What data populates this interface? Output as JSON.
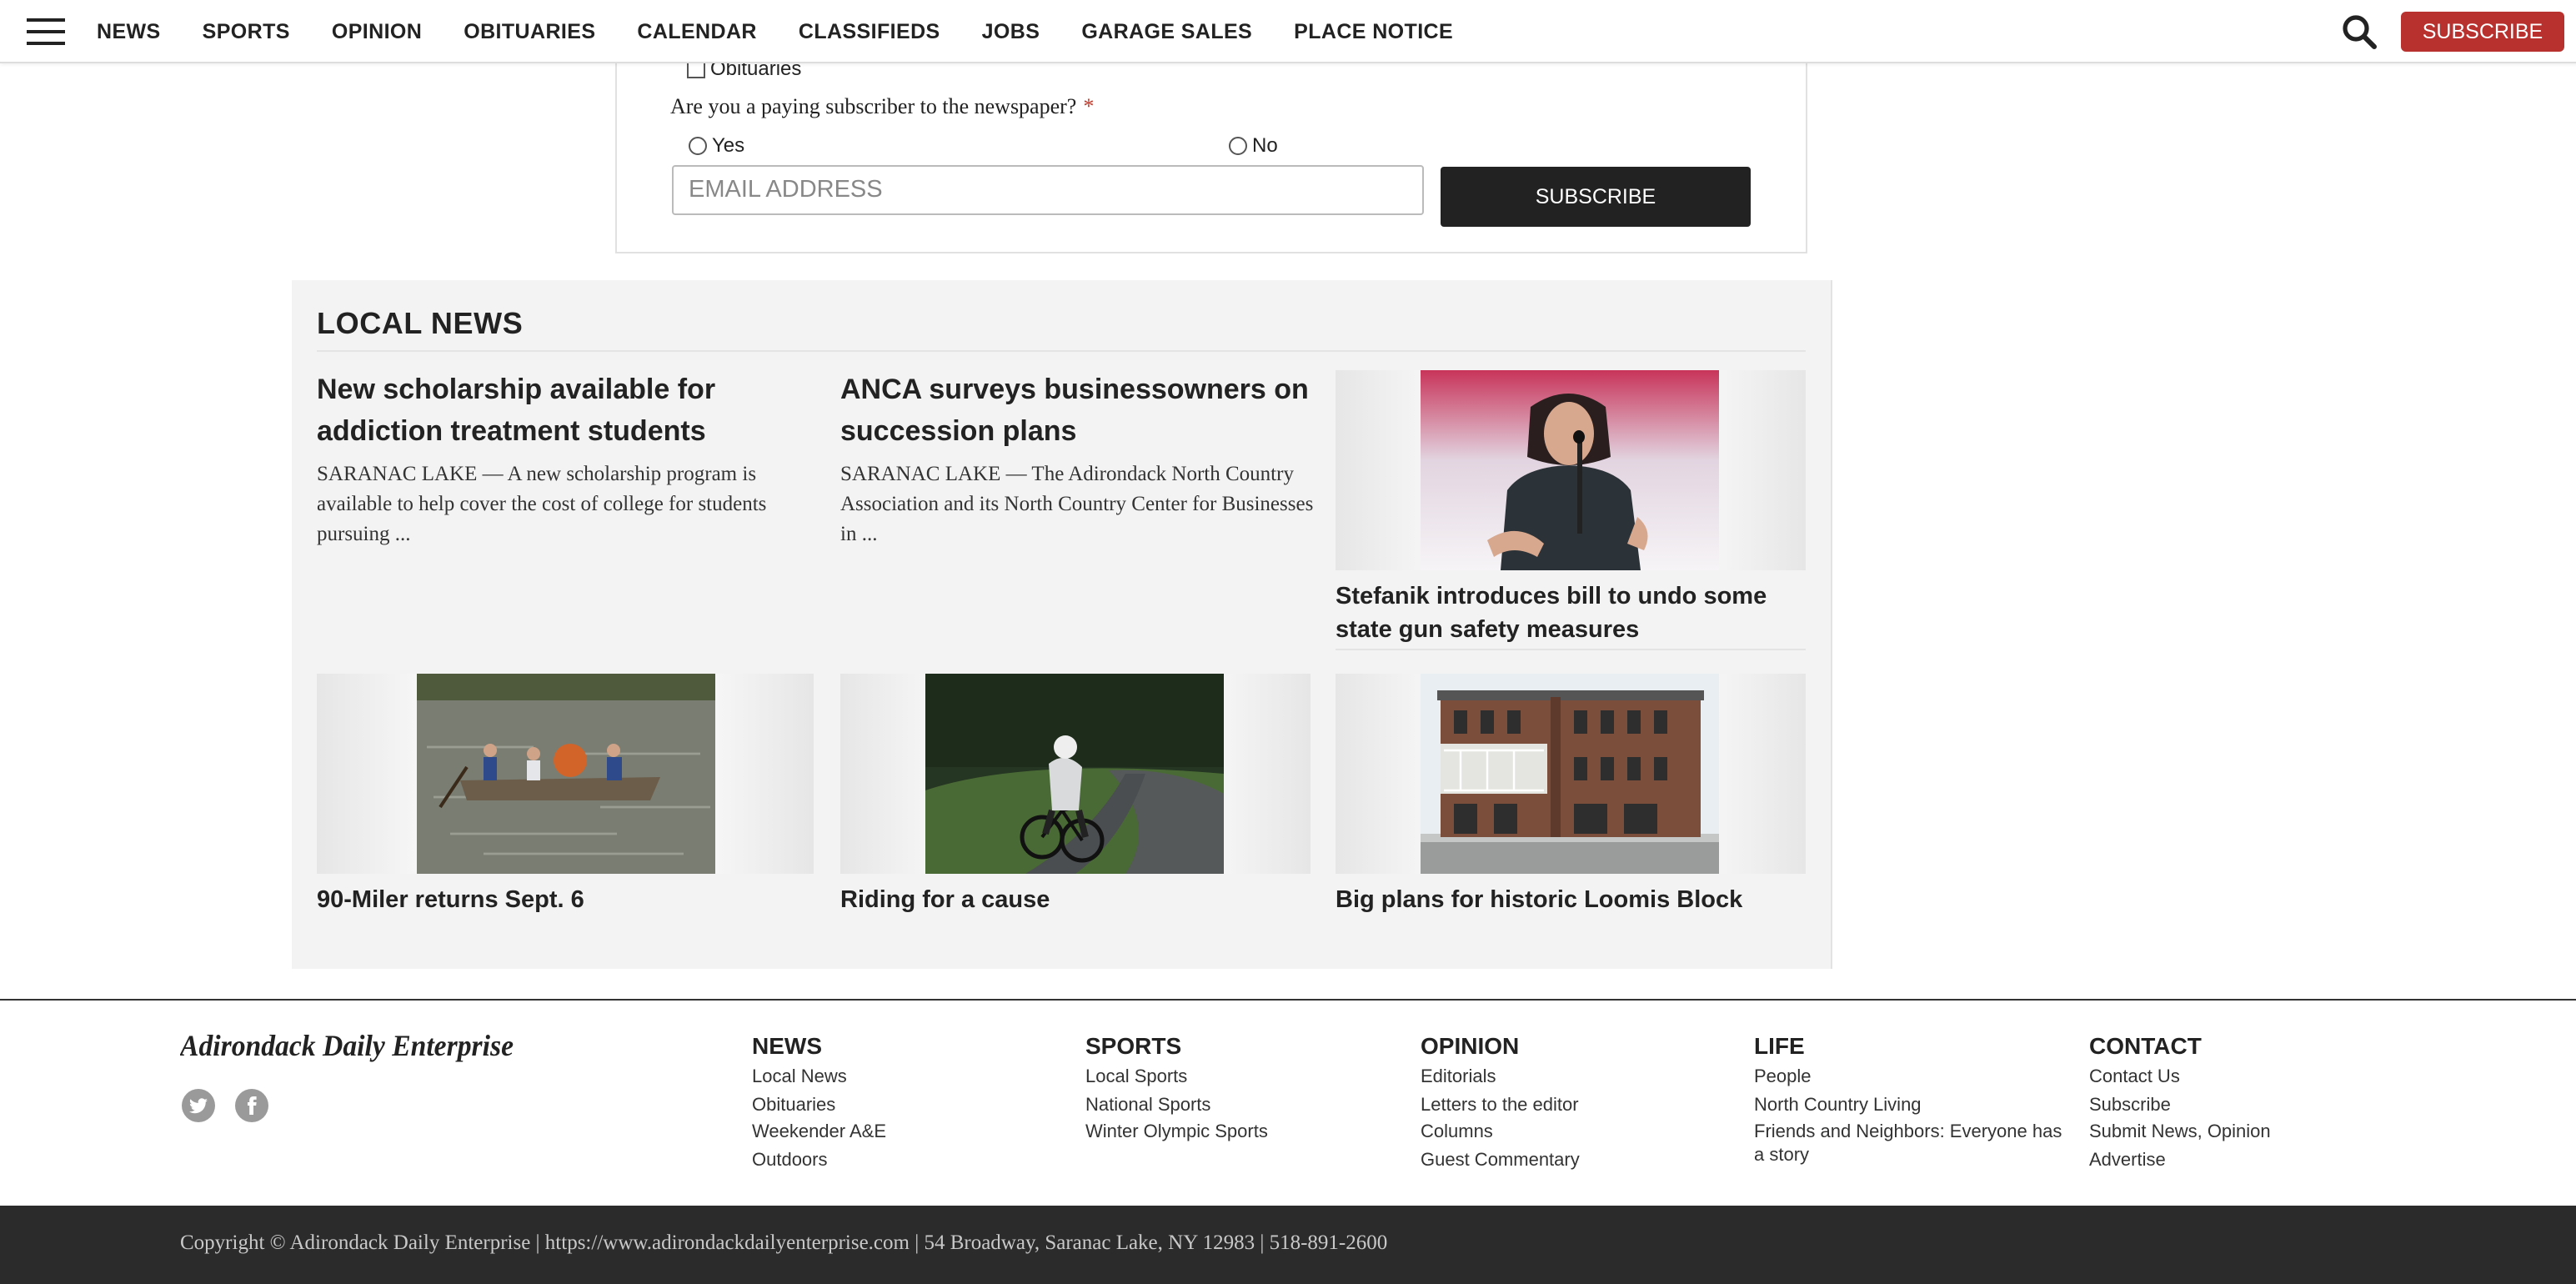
{
  "nav": {
    "items": [
      "NEWS",
      "SPORTS",
      "OPINION",
      "OBITUARIES",
      "CALENDAR",
      "CLASSIFIEDS",
      "JOBS",
      "GARAGE SALES",
      "PLACE NOTICE"
    ],
    "subscribe": "SUBSCRIBE"
  },
  "form": {
    "obituaries_option": "Obituaries",
    "question": "Are you a paying subscriber to the newspaper?",
    "required_mark": "*",
    "yes": "Yes",
    "no": "No",
    "email_placeholder": "EMAIL ADDRESS",
    "submit": "SUBSCRIBE"
  },
  "local_news": {
    "title": "LOCAL NEWS",
    "stories": [
      {
        "headline": "New scholarship available for addiction treatment students",
        "summary": "SARANAC LAKE — A new scholarship program is available to help cover the cost of college for students pursuing ..."
      },
      {
        "headline": "ANCA surveys businessowners on succession plans",
        "summary": "SARANAC LAKE — The Adirondack North Country Association and its North Country Center for Businesses in ..."
      },
      {
        "headline": "Stefanik introduces bill to undo some state gun safety measures"
      },
      {
        "headline": "90-Miler returns Sept. 6"
      },
      {
        "headline": "Riding for a cause"
      },
      {
        "headline": "Big plans for historic Loomis Block"
      }
    ]
  },
  "footer": {
    "logo": "Adirondack Daily Enterprise",
    "columns": [
      {
        "heading": "NEWS",
        "links": [
          "Local News",
          "Obituaries",
          "Weekender A&E",
          "Outdoors"
        ]
      },
      {
        "heading": "SPORTS",
        "links": [
          "Local Sports",
          "National Sports",
          "Winter Olympic Sports"
        ]
      },
      {
        "heading": "OPINION",
        "links": [
          "Editorials",
          "Letters to the editor",
          "Columns",
          "Guest Commentary"
        ]
      },
      {
        "heading": "LIFE",
        "links": [
          "People",
          "North Country Living",
          "Friends and Neighbors: Everyone has a story"
        ]
      },
      {
        "heading": "CONTACT",
        "links": [
          "Contact Us",
          "Subscribe",
          "Submit News, Opinion",
          "Advertise"
        ]
      }
    ],
    "copyright": "Copyright © Adirondack Daily Enterprise | https://www.adirondackdailyenterprise.com | 54 Broadway, Saranac Lake, NY 12983 | 518-891-2600"
  },
  "icons": {
    "menu": "hamburger-menu-icon",
    "search": "search-icon",
    "twitter": "twitter-icon",
    "facebook": "facebook-icon"
  },
  "colors": {
    "accent": "#b8312f",
    "dark_button": "#222222",
    "footer_bar": "#2b2b2b"
  }
}
